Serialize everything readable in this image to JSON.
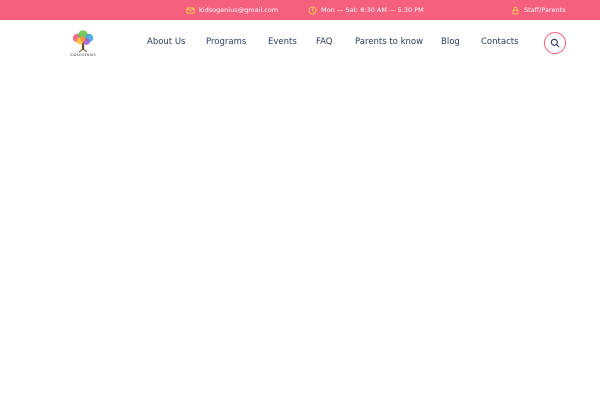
{
  "topbar": {
    "email": "kidsogenius@gmail.com",
    "hours": "Mon — Sat: 8:30 AM — 5:30 PM",
    "login": "Staff/Parents"
  },
  "header": {
    "logo_caption": "KIDSOGENIUS"
  },
  "nav": {
    "items": [
      "About Us",
      "Programs",
      "Events",
      "FAQ",
      "Parents to know",
      "Blog",
      "Contacts"
    ]
  },
  "colors": {
    "accent": "#f4607e",
    "topbar_icon": "#ffd34d",
    "nav_text": "#2f3a5b"
  }
}
